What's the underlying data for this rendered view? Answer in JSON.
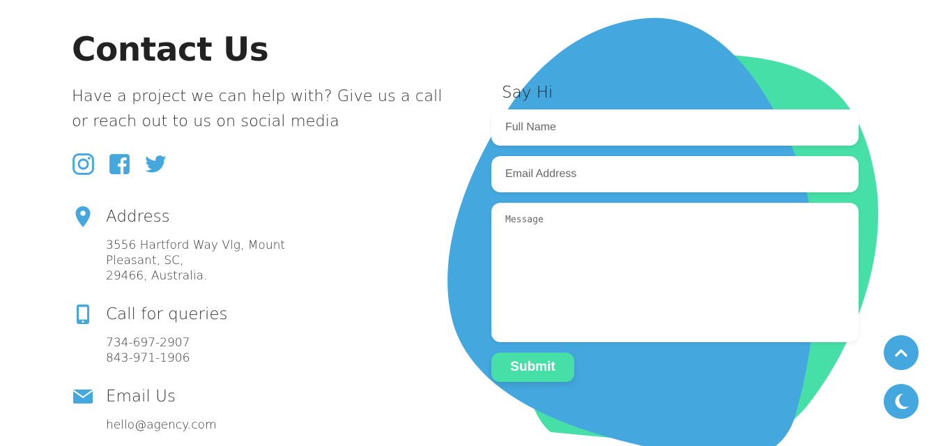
{
  "contact": {
    "title": "Contact Us",
    "lead": "Have a project we can help with? Give us a call or reach out to us on social media"
  },
  "social": [
    {
      "icon": "instagram-icon"
    },
    {
      "icon": "facebook-icon"
    },
    {
      "icon": "twitter-icon"
    }
  ],
  "address": {
    "icon": "map-pin-icon",
    "label": "Address",
    "lines": [
      "3556 Hartford Way Vlg, Mount",
      "Pleasant, SC,",
      "29466, Australia."
    ]
  },
  "phone": {
    "icon": "mobile-phone-icon",
    "label": "Call for queries",
    "lines": [
      "734-697-2907",
      "843-971-1906"
    ]
  },
  "email": {
    "icon": "envelope-icon",
    "label": "Email Us",
    "lines": [
      "hello@agency.com"
    ]
  },
  "form": {
    "heading": "Say Hi",
    "name_placeholder": "Full Name",
    "email_placeholder": "Email Address",
    "message_placeholder": "Message",
    "submit_label": "Submit"
  },
  "floating": {
    "scroll_top_icon": "chevron-up-icon",
    "theme_toggle_icon": "moon-icon"
  },
  "colors": {
    "accent_blue": "#44a8df",
    "accent_green": "#47dfa8",
    "text": "#222222"
  }
}
